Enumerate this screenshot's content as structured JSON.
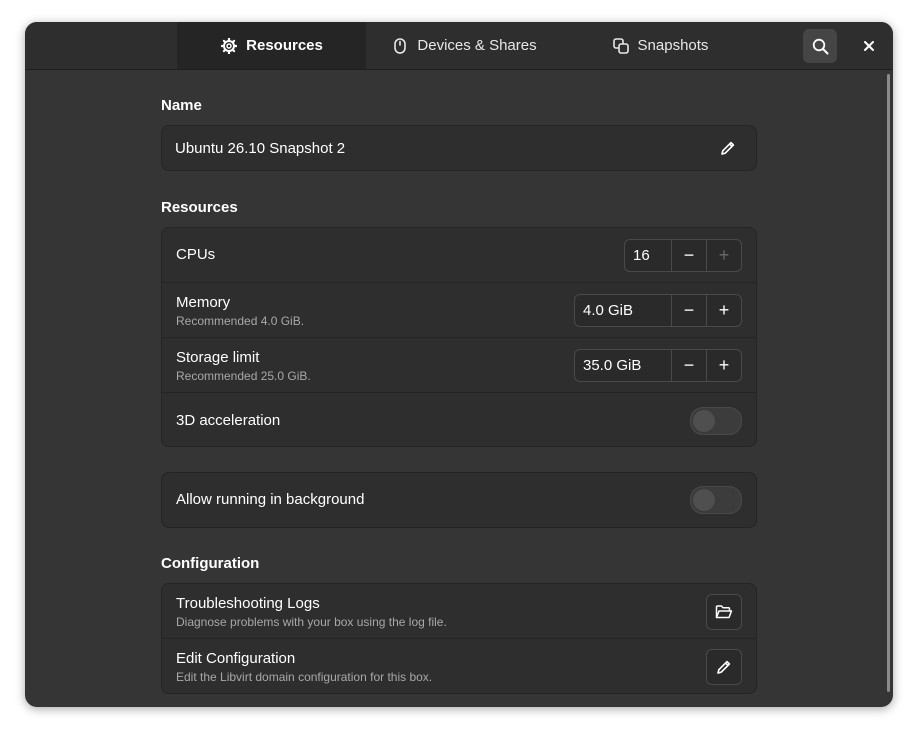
{
  "header": {
    "tabs": [
      {
        "label": "Resources",
        "icon": "gear-icon",
        "active": true
      },
      {
        "label": "Devices & Shares",
        "icon": "mouse-icon",
        "active": false
      },
      {
        "label": "Snapshots",
        "icon": "copy-icon",
        "active": false
      }
    ],
    "search_icon": "search-icon",
    "close_icon": "close-icon"
  },
  "name_section": {
    "title": "Name",
    "value": "Ubuntu 26.10 Snapshot 2",
    "edit_icon": "pencil-icon"
  },
  "resources_section": {
    "title": "Resources",
    "cpus": {
      "label": "CPUs",
      "value": "16",
      "minus": "−",
      "plus": "+",
      "plus_disabled": true
    },
    "memory": {
      "label": "Memory",
      "subtitle": "Recommended 4.0 GiB.",
      "value": "4.0 GiB",
      "minus": "−",
      "plus": "+"
    },
    "storage": {
      "label": "Storage limit",
      "subtitle": "Recommended 25.0 GiB.",
      "value": "35.0 GiB",
      "minus": "−",
      "plus": "+"
    },
    "acceleration": {
      "label": "3D acceleration",
      "enabled": false
    }
  },
  "background": {
    "label": "Allow running in background",
    "enabled": false
  },
  "configuration_section": {
    "title": "Configuration",
    "logs": {
      "title": "Troubleshooting Logs",
      "subtitle": "Diagnose problems with your box using the log file.",
      "icon": "folder-open-icon"
    },
    "edit": {
      "title": "Edit Configuration",
      "subtitle": "Edit the Libvirt domain configuration for this box.",
      "icon": "pencil-icon"
    }
  },
  "colors": {
    "window_bg": "#353535",
    "card_bg": "#2e2e2e",
    "header_bg": "#2e2e2e",
    "active_tab_bg": "#252525"
  }
}
